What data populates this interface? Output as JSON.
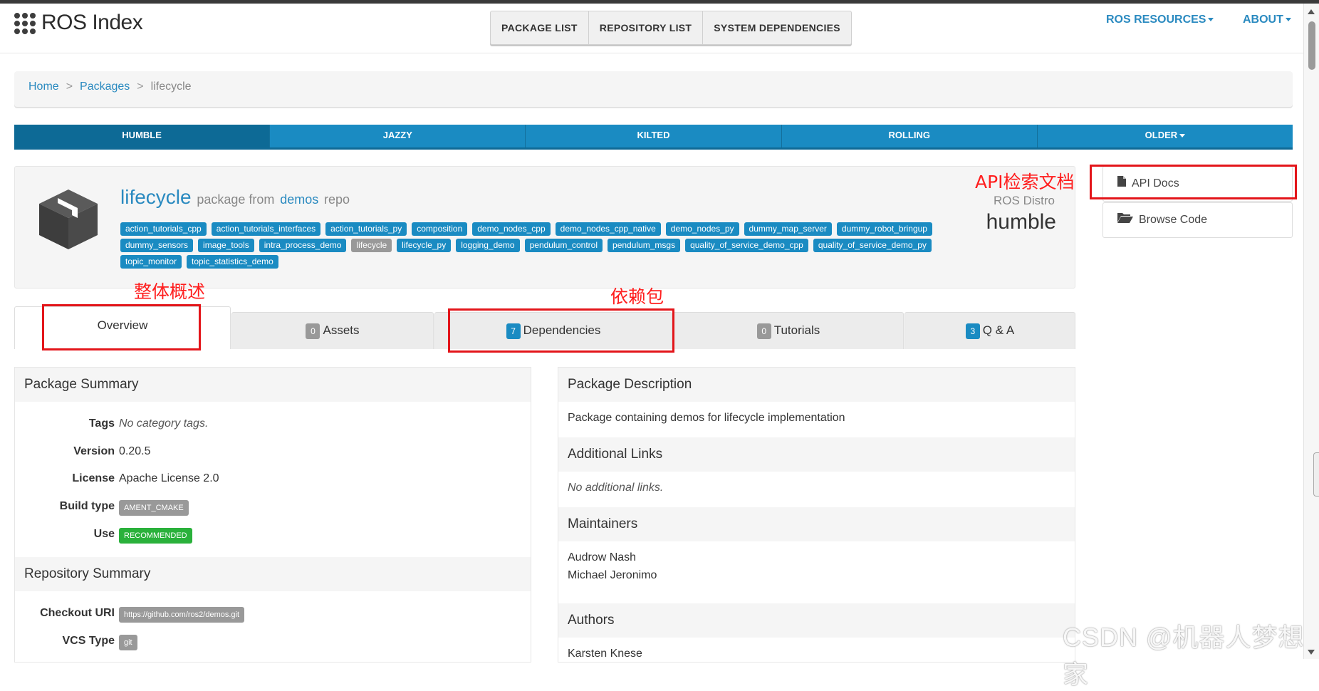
{
  "brand": {
    "name": "ROS Index"
  },
  "nav": {
    "center": [
      "PACKAGE LIST",
      "REPOSITORY LIST",
      "SYSTEM DEPENDENCIES"
    ],
    "resources": "ROS RESOURCES",
    "about": "ABOUT"
  },
  "breadcrumb": {
    "home": "Home",
    "sep": ">",
    "packages": "Packages",
    "current": "lifecycle"
  },
  "distros": [
    "HUMBLE",
    "JAZZY",
    "KILTED",
    "ROLLING",
    "OLDER"
  ],
  "package": {
    "name": "lifecycle",
    "from_text": "package from",
    "repo": "demos",
    "repo_suffix": "repo",
    "distro_label": "ROS Distro",
    "distro": "humble",
    "tags": [
      "action_tutorials_cpp",
      "action_tutorials_interfaces",
      "action_tutorials_py",
      "composition",
      "demo_nodes_cpp",
      "demo_nodes_cpp_native",
      "demo_nodes_py",
      "dummy_map_server",
      "dummy_robot_bringup",
      "dummy_sensors",
      "image_tools",
      "intra_process_demo",
      "lifecycle",
      "lifecycle_py",
      "logging_demo",
      "pendulum_control",
      "pendulum_msgs",
      "quality_of_service_demo_cpp",
      "quality_of_service_demo_py",
      "topic_monitor",
      "topic_statistics_demo"
    ]
  },
  "side_buttons": {
    "api_docs": "API Docs",
    "browse_code": "Browse Code"
  },
  "annotations": {
    "api": "API检索文档",
    "overview": "整体概述",
    "deps": "依赖包"
  },
  "tabs": {
    "overview": "Overview",
    "assets": {
      "count": "0",
      "label": "Assets"
    },
    "dependencies": {
      "count": "7",
      "label": "Dependencies"
    },
    "tutorials": {
      "count": "0",
      "label": "Tutorials"
    },
    "qa": {
      "count": "3",
      "label": "Q & A"
    }
  },
  "summary": {
    "title": "Package Summary",
    "tags_k": "Tags",
    "tags_v": "No category tags.",
    "version_k": "Version",
    "version_v": "0.20.5",
    "license_k": "License",
    "license_v": "Apache License 2.0",
    "build_k": "Build type",
    "build_v": "AMENT_CMAKE",
    "use_k": "Use",
    "use_v": "RECOMMENDED"
  },
  "repo_summary": {
    "title": "Repository Summary",
    "checkout_k": "Checkout URI",
    "checkout_v": "https://github.com/ros2/demos.git",
    "vcs_k": "VCS Type",
    "vcs_v": "git"
  },
  "description": {
    "title": "Package Description",
    "text": "Package containing demos for lifecycle implementation",
    "links_title": "Additional Links",
    "links_text": "No additional links.",
    "maint_title": "Maintainers",
    "maint_1": "Audrow Nash",
    "maint_2": "Michael Jeronimo",
    "authors_title": "Authors",
    "author_1": "Karsten Knese"
  },
  "watermark": "CSDN @机器人梦想家",
  "colors": {
    "accent": "#1a8bc2",
    "annotation": "#e3151a",
    "success": "#2ab13b"
  }
}
